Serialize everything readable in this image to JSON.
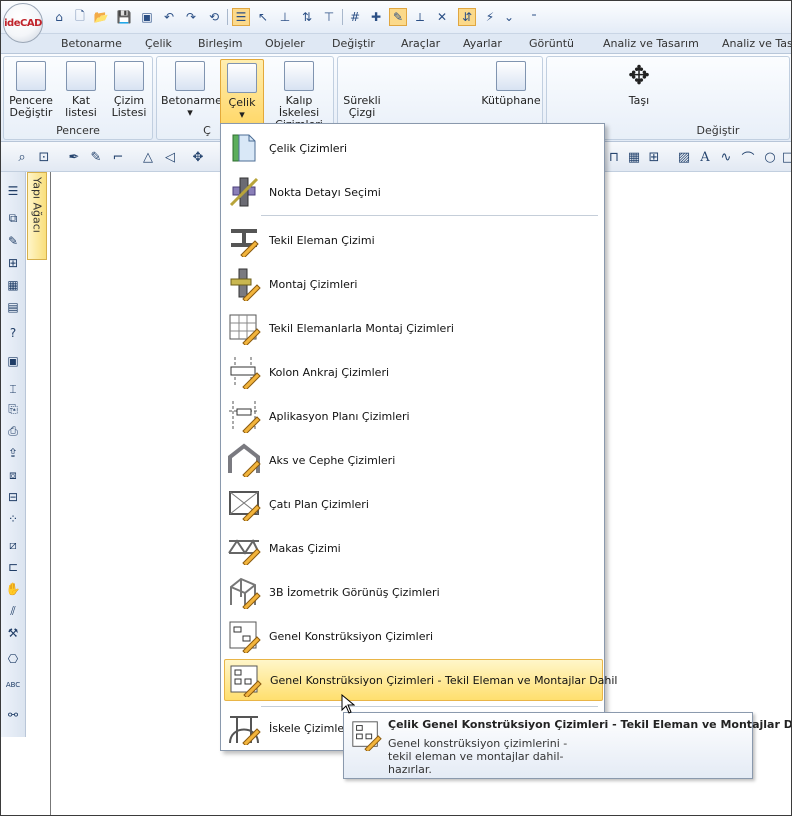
{
  "app": {
    "logo_text": "ideCAD"
  },
  "menu_tabs": [
    "Betonarme",
    "Çelik",
    "Birleşim",
    "Objeler",
    "Değiştir",
    "Araçlar",
    "Ayarlar",
    "Görüntü",
    "Analiz ve Tasarım",
    "Analiz ve Tasarım"
  ],
  "ribbon": {
    "pencere": {
      "btn1": "Pencere Değiştir",
      "btn2": "Kat listesi",
      "btn3": "Çizim Listesi",
      "group_label": "Pencere"
    },
    "cizim": {
      "betonarme": "Betonarme",
      "celik": "Çelik",
      "kalip": "Kalıp İskelesi Çizimleri",
      "group_label_partial": "Ç"
    },
    "objeler": {
      "surekli": "Sürekli Çizgi",
      "kutuphane": "Kütüphane"
    },
    "degistir": {
      "tasi": "Taşı",
      "group_label": "Değiştir"
    }
  },
  "left_panel": {
    "tab_label": "Yapı Ağacı"
  },
  "dropdown": {
    "items": [
      {
        "label": "Çelik Çizimleri"
      },
      {
        "label": "Nokta Detayı Seçimi"
      },
      {
        "label": "Tekil Eleman Çizimi"
      },
      {
        "label": "Montaj Çizimleri"
      },
      {
        "label": "Tekil Elemanlarla Montaj Çizimleri"
      },
      {
        "label": "Kolon Ankraj Çizimleri"
      },
      {
        "label": "Aplikasyon Planı Çizimleri"
      },
      {
        "label": "Aks ve Cephe Çizimleri"
      },
      {
        "label": "Çatı Plan Çizimleri"
      },
      {
        "label": "Makas Çizimi"
      },
      {
        "label": "3B İzometrik Görünüş Çizimleri"
      },
      {
        "label": "Genel Konstrüksiyon Çizimleri"
      },
      {
        "label": "Genel Konstrüksiyon Çizimleri - Tekil Eleman ve Montajlar Dahil"
      },
      {
        "label": "İskele Çizimleri"
      }
    ],
    "highlighted_index": 12
  },
  "tooltip": {
    "title": "Çelik Genel Konstrüksiyon Çizimleri - Tekil Eleman ve Montajlar Dahil",
    "description": "Genel konstrüksiyon çizimlerini - tekil eleman ve montajlar dahil- hazırlar."
  },
  "colors": {
    "highlight": "#ffdf6e",
    "accent": "#e9b548",
    "ribbon_bg": "#e3ebf6"
  }
}
